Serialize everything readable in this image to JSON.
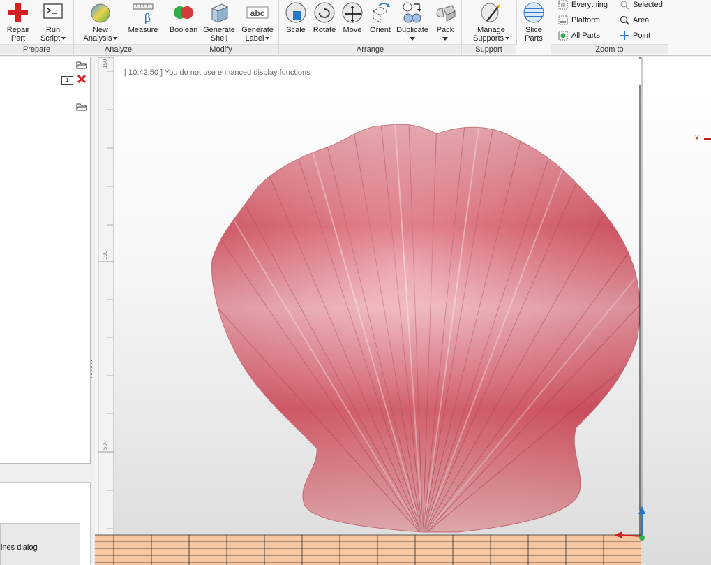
{
  "ribbon": {
    "groups": {
      "prepare": {
        "label": "Prepare",
        "repair_part": {
          "line1": "Repair",
          "line2": "Part"
        },
        "run_script": {
          "line1": "Run",
          "line2": "Script"
        }
      },
      "analyze": {
        "label": "Analyze",
        "new_analysis": {
          "line1": "New",
          "line2": "Analysis"
        },
        "measure": {
          "label": "Measure"
        }
      },
      "modify": {
        "label": "Modify",
        "boolean": {
          "label": "Boolean"
        },
        "generate_shell": {
          "line1": "Generate",
          "line2": "Shell"
        },
        "generate_label": {
          "line1": "Generate",
          "line2": "Label",
          "icon_text": "abc"
        }
      },
      "arrange": {
        "label": "Arrange",
        "scale": {
          "label": "Scale"
        },
        "rotate": {
          "label": "Rotate"
        },
        "move": {
          "label": "Move"
        },
        "orient": {
          "label": "Orient"
        },
        "duplicate": {
          "label": "Duplicate"
        },
        "pack": {
          "label": "Pack"
        }
      },
      "support": {
        "label": "Support",
        "manage_supports": {
          "line1": "Manage",
          "line2": "Supports"
        },
        "slice_parts": {
          "line1": "Slice",
          "line2": "Parts"
        }
      },
      "zoom": {
        "label": "Zoom to",
        "everything": "Everything",
        "selected": "Selected",
        "platform": "Platform",
        "area": "Area",
        "all_parts": "All Parts",
        "point": "Point"
      }
    }
  },
  "left_panel": {
    "badge": "1",
    "lines_dialog_label": "ines dialog"
  },
  "viewport": {
    "log_message": "[ 10:42:50 ] You do not use enhanced display functions",
    "axis_x_label": "x",
    "ruler_labels": [
      "150",
      "100",
      "50"
    ]
  },
  "icons": [
    "repair-cross-icon",
    "terminal-icon",
    "analysis-sphere-icon",
    "ruler-beta-icon",
    "boolean-spheres-icon",
    "shell-cube-icon",
    "label-abc-icon",
    "scale-icon",
    "rotate-icon",
    "move-icon",
    "orient-icon",
    "duplicate-icon",
    "pack-icon",
    "support-wand-icon",
    "slice-icon",
    "folder-open-icon",
    "delete-x-icon"
  ],
  "colors": {
    "accent_blue": "#2a78c8",
    "delete_red": "#d32020",
    "shell_pink": "#e26a78",
    "platform_orange": "#f7c7a2"
  }
}
